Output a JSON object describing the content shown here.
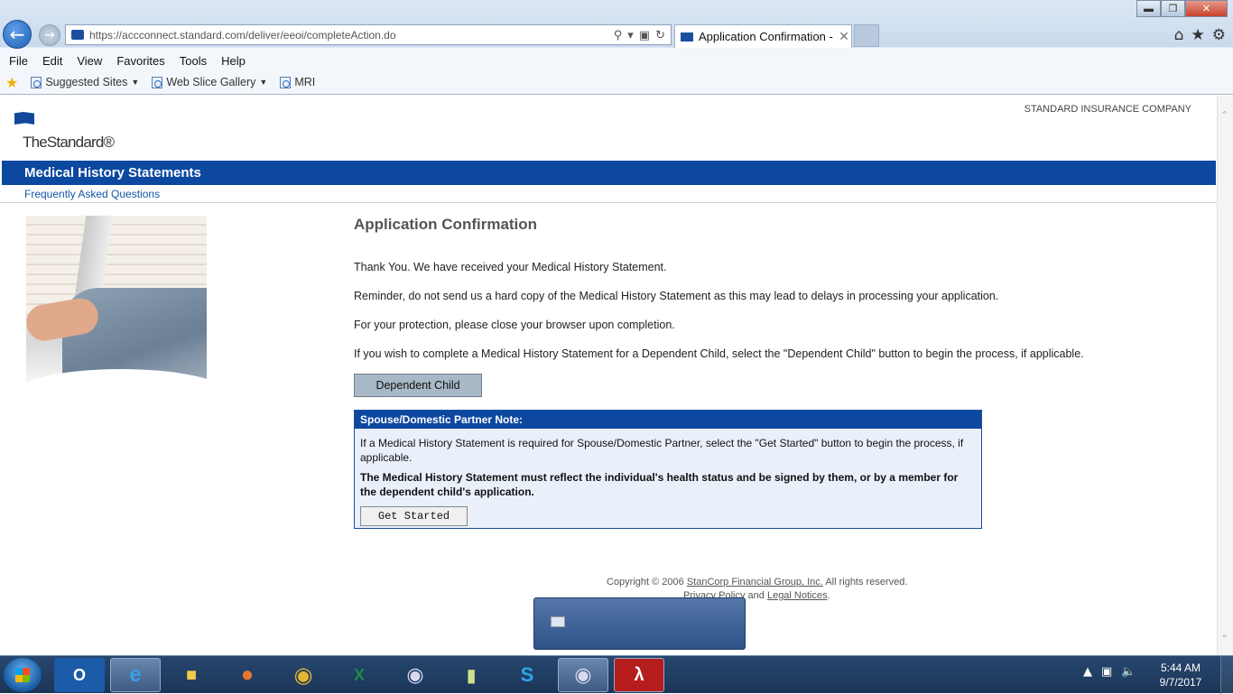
{
  "browser": {
    "url": "https://accconnect.standard.com/deliver/eeoi/completeAction.do",
    "tab_title": "Application Confirmation - ...",
    "menu": [
      "File",
      "Edit",
      "View",
      "Favorites",
      "Tools",
      "Help"
    ],
    "favorites": [
      {
        "label": "Suggested Sites",
        "dropdown": true
      },
      {
        "label": "Web Slice Gallery",
        "dropdown": true
      },
      {
        "label": "MRI",
        "dropdown": false
      }
    ],
    "icons": {
      "back": "back-arrow-icon",
      "forward": "forward-arrow-icon",
      "home": "home-icon",
      "favorites": "star-icon",
      "tools": "gear-icon"
    }
  },
  "page": {
    "company": "STANDARD INSURANCE COMPANY",
    "logo_text": "TheStandard®",
    "band_title": "Medical History Statements",
    "faq_link": "Frequently Asked Questions",
    "heading": "Application Confirmation",
    "paragraphs": [
      "Thank You. We have received your Medical History Statement.",
      "Reminder, do not send us a hard copy of the Medical History Statement as this may lead to delays in processing your application.",
      "For your protection, please close your browser upon completion.",
      "If you wish to complete a Medical History Statement for a Dependent Child, select the \"Dependent Child\" button to begin the process, if applicable."
    ],
    "dependent_button": "Dependent Child",
    "note": {
      "title": "Spouse/Domestic Partner Note:",
      "text": "If a Medical History Statement is required for Spouse/Domestic Partner, select the \"Get Started\" button to begin the process, if applicable.",
      "bold_text": "The Medical History Statement must reflect the individual's health status and be signed by them, or by a member for the dependent child's application.",
      "button": "Get Started"
    },
    "footer": {
      "copyright_prefix": "Copyright © 2006",
      "company_link": "StanCorp Financial Group, Inc.",
      "rights": "All rights reserved.",
      "privacy_link": "Privacy Policy",
      "and": "and",
      "legal_link": "Legal Notices",
      "period": "."
    }
  },
  "taskbar": {
    "apps": [
      "outlook",
      "internet-explorer",
      "file-explorer",
      "firefox",
      "chrome",
      "excel",
      "eclipse",
      "notes",
      "skype",
      "eclipse",
      "acrobat"
    ],
    "time": "5:44 AM",
    "date": "9/7/2017"
  },
  "colors": {
    "brand_blue": "#0d48a0",
    "link": "#1356a6",
    "button_gray": "#a9b8c6"
  }
}
